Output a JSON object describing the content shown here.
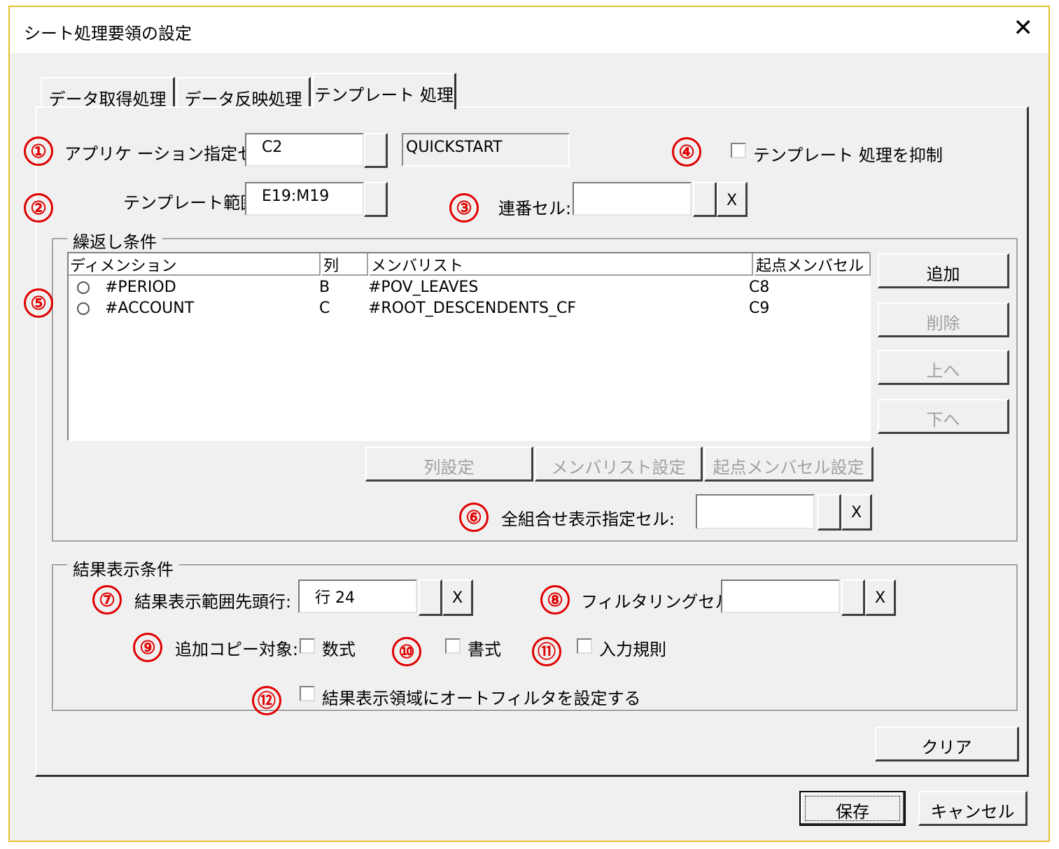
{
  "window": {
    "title": "シート処理要領の設定",
    "close_glyph": "✕"
  },
  "tabs": [
    {
      "label": "データ取得処理",
      "active": false
    },
    {
      "label": "データ反映処理",
      "active": false
    },
    {
      "label": "テンプレート 処理",
      "active": true
    }
  ],
  "markers": [
    "①",
    "②",
    "③",
    "④",
    "⑤",
    "⑥",
    "⑦",
    "⑧",
    "⑨",
    "⑩",
    "⑪",
    "⑫"
  ],
  "app_cell": {
    "label": "アプリケ ーション指定セル:",
    "value": "C2",
    "app_name": "QUICKSTART"
  },
  "suppress_template": {
    "label": "テンプレート 処理を抑制",
    "checked": false
  },
  "template_range": {
    "label": "テンプレート範囲:",
    "value": "E19:M19"
  },
  "serial_cell": {
    "label": "連番セル:",
    "value": "",
    "clear_label": "X"
  },
  "repeat": {
    "group_title": "繰返し条件",
    "columns": [
      "ディメンション",
      "列",
      "メンバリスト",
      "起点メンバセル"
    ],
    "rows": [
      {
        "dimension": "#PERIOD",
        "column": "B",
        "member_list": "#POV_LEAVES",
        "start_cell": "C8"
      },
      {
        "dimension": "#ACCOUNT",
        "column": "C",
        "member_list": "#ROOT_DESCENDENTS_CF",
        "start_cell": "C9"
      }
    ],
    "add_label": "追加",
    "delete_label": "削除",
    "up_label": "上へ",
    "down_label": "下へ",
    "col_setting_label": "列設定",
    "member_setting_label": "メンバリスト設定",
    "start_setting_label": "起点メンバセル設定",
    "all_combo_label": "全組合せ表示指定セル:",
    "all_combo_value": "",
    "clear_label": "X"
  },
  "result": {
    "group_title": "結果表示条件",
    "start_row_label": "結果表示範囲先頭行:",
    "start_row_value": "行 24",
    "filter_cell_label": "フィルタリングセル:",
    "filter_cell_value": "",
    "clear_label": "X",
    "copy_target_label": "追加コピー対象:",
    "formula_label": "数式",
    "format_label": "書式",
    "validation_label": "入力規則",
    "autofilter_label": "結果表示領域にオートフィルタを設定する"
  },
  "buttons": {
    "clear": "クリア",
    "save": "保存",
    "cancel": "キャンセル"
  },
  "colors": {
    "marker": "#e00000",
    "window_border": "#e8c02a",
    "dialog_bg": "#f0f0f0"
  }
}
